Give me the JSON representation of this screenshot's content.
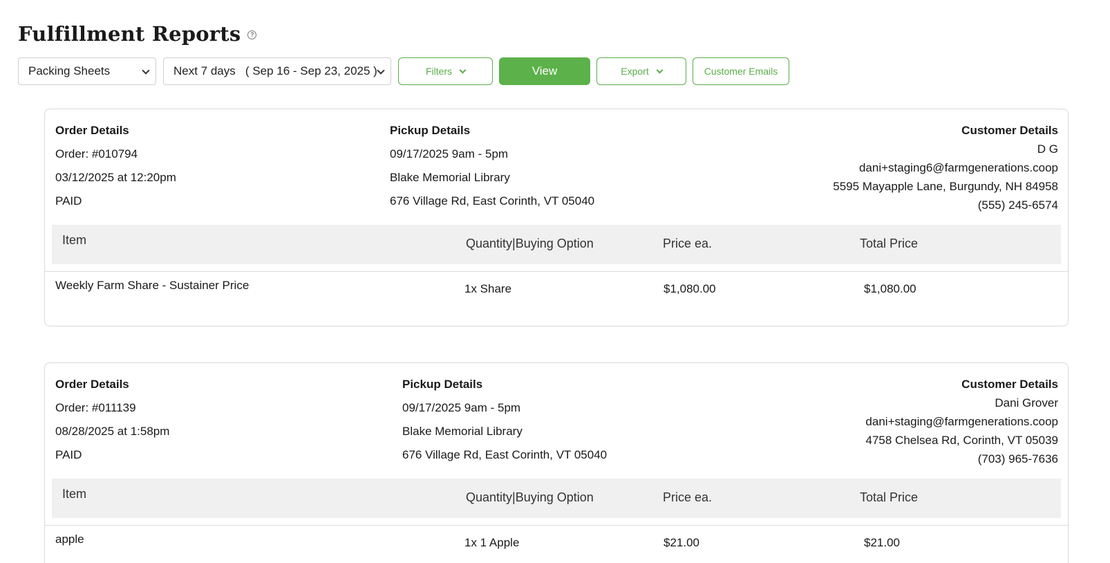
{
  "header": {
    "title": "Fulfillment Reports",
    "help_icon": "question-circle-icon"
  },
  "toolbar": {
    "report_type": "Packing Sheets",
    "date_range": "Next 7 days   ( Sep 16 - Sep 23, 2025 )",
    "filters_label": "Filters",
    "view_label": "View",
    "export_label": "Export",
    "customer_emails_label": "Customer Emails"
  },
  "table_headers": {
    "item": "Item",
    "quantity": "Quantity|Buying Option",
    "price_each": "Price ea.",
    "total_price": "Total Price"
  },
  "orders": [
    {
      "order_heading": "Order Details",
      "order_number": "Order: #010794",
      "order_date": "03/12/2025 at 12:20pm",
      "status": "PAID",
      "pickup_heading": "Pickup Details",
      "pickup_time": "09/17/2025 9am - 5pm",
      "pickup_location": "Blake Memorial Library",
      "pickup_address": "676 Village Rd, East Corinth, VT 05040",
      "customer_heading": "Customer Details",
      "customer_name": "D G",
      "customer_email": "dani+staging6@farmgenerations.coop",
      "customer_address": "5595 Mayapple Lane, Burgundy, NH 84958",
      "customer_phone": "(555) 245-6574",
      "items": [
        {
          "item": "Weekly Farm Share - Sustainer Price",
          "quantity": "1x Share",
          "price_each": "$1,080.00",
          "total": "$1,080.00"
        }
      ]
    },
    {
      "order_heading": "Order Details",
      "order_number": "Order: #011139",
      "order_date": "08/28/2025 at 1:58pm",
      "status": "PAID",
      "pickup_heading": "Pickup Details",
      "pickup_time": "09/17/2025 9am - 5pm",
      "pickup_location": "Blake Memorial Library",
      "pickup_address": "676 Village Rd, East Corinth, VT 05040",
      "customer_heading": "Customer Details",
      "customer_name": "Dani Grover",
      "customer_email": "dani+staging@farmgenerations.coop",
      "customer_address": "4758 Chelsea Rd, Corinth, VT 05039",
      "customer_phone": "(703) 965-7636",
      "items": [
        {
          "item": "apple",
          "quantity": "1x 1 Apple",
          "price_each": "$21.00",
          "total": "$21.00"
        }
      ]
    }
  ]
}
